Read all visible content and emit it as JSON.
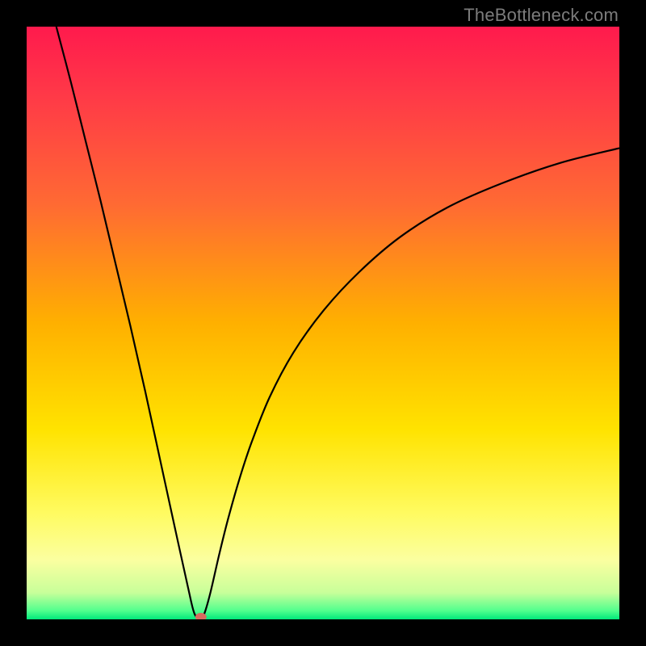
{
  "watermark": "TheBottleneck.com",
  "colors": {
    "frame": "#000000",
    "gradient_stops": [
      {
        "offset": 0.0,
        "color": "#ff1a4d"
      },
      {
        "offset": 0.12,
        "color": "#ff3a47"
      },
      {
        "offset": 0.3,
        "color": "#ff6a33"
      },
      {
        "offset": 0.5,
        "color": "#ffb000"
      },
      {
        "offset": 0.68,
        "color": "#ffe300"
      },
      {
        "offset": 0.82,
        "color": "#fffb60"
      },
      {
        "offset": 0.9,
        "color": "#fbffa0"
      },
      {
        "offset": 0.955,
        "color": "#c8ff9a"
      },
      {
        "offset": 0.985,
        "color": "#53ff8e"
      },
      {
        "offset": 1.0,
        "color": "#00e87b"
      }
    ],
    "curve": "#000000",
    "marker": "#d86a5f"
  },
  "chart_data": {
    "type": "line",
    "title": "",
    "xlabel": "",
    "ylabel": "",
    "xlim": [
      0,
      100
    ],
    "ylim": [
      0,
      100
    ],
    "series": [
      {
        "name": "bottleneck-curve",
        "x": [
          5.0,
          7.5,
          10.0,
          12.5,
          15.0,
          17.5,
          20.0,
          22.5,
          25.0,
          27.2,
          28.3,
          29.4,
          30.0,
          31.0,
          32.5,
          34.0,
          36.0,
          38.0,
          41.0,
          45.0,
          50.0,
          56.0,
          63.0,
          71.0,
          80.0,
          90.0,
          100.0
        ],
        "values": [
          100.0,
          90.5,
          80.5,
          70.5,
          60.0,
          49.5,
          38.5,
          27.0,
          15.5,
          5.5,
          1.0,
          0.0,
          1.0,
          4.5,
          11.0,
          17.0,
          24.0,
          30.0,
          37.5,
          45.0,
          52.0,
          58.5,
          64.5,
          69.5,
          73.5,
          77.0,
          79.5
        ]
      }
    ],
    "marker": {
      "x": 29.4,
      "y": 0.0
    },
    "legend": []
  }
}
